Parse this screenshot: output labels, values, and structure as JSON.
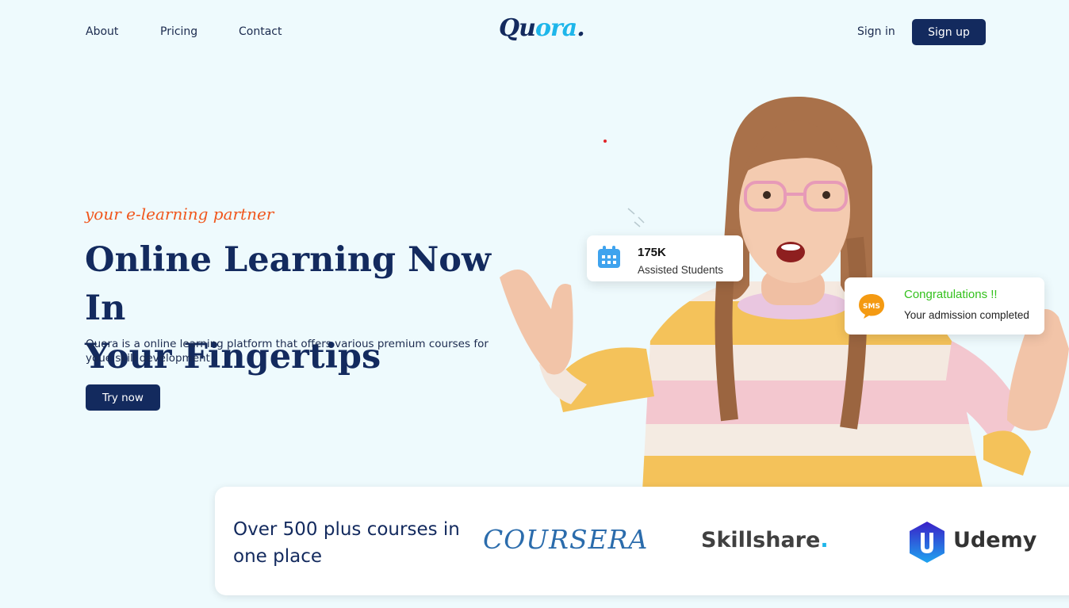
{
  "nav": {
    "links": [
      "About",
      "Pricing",
      "Contact"
    ],
    "logo_main": "Qu",
    "logo_accent": "ora",
    "logo_end": ".",
    "signin": "Sign in",
    "signup": "Sign up"
  },
  "hero": {
    "tagline": "your e-learning partner",
    "headline_line1": "Online Learning Now In",
    "headline_line2": "Your Fingertips",
    "description": "Quora is a online learning platform that offers various premium courses for youe skill development",
    "cta": "Try now"
  },
  "cards": {
    "students_count": "175K",
    "students_label": "Assisted Students",
    "congrats_title": "Congratulations !!",
    "congrats_message": "Your admission completed"
  },
  "partners": {
    "heading": "Over 500 plus courses in one place",
    "coursera": "COURSERA",
    "skillshare": "Skillshare",
    "skillshare_dot": ".",
    "udemy": "Udemy"
  },
  "colors": {
    "navy": "#132a5e",
    "accent_blue": "#1eb6ea",
    "tagline_orange": "#f0571d",
    "congrats_green": "#34c11d",
    "background": "#eefafd"
  }
}
